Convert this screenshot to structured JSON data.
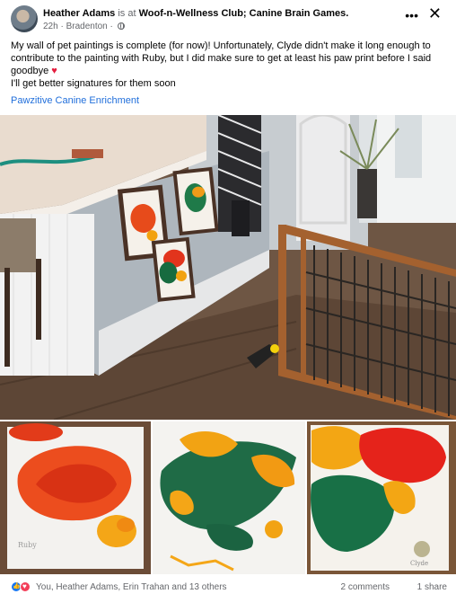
{
  "post": {
    "author": "Heather Adams",
    "is_at": "is at",
    "group": "Woof-n-Wellness Club; Canine Brain Games.",
    "time": "22h",
    "location": "Bradenton",
    "text_line1": "My wall of pet paintings is complete (for now)! Unfortunately, Clyde didn't make it long enough to contribute to the painting with Ruby, but I did make sure to get at least his paw print before I said goodbye",
    "text_line2": "I'll get better signatures for them soon",
    "tag": "Pawzitive Canine Enrichment"
  },
  "footer": {
    "reactors": "You, Heather Adams, Erin Trahan and 13 others",
    "comments": "2 comments",
    "shares": "1 share"
  },
  "icons": [
    "more-icon",
    "close-icon",
    "globe-icon",
    "heart-icon",
    "like-icon",
    "love-icon"
  ],
  "colors": {
    "link": "#216fdb",
    "secondary_text": "#65676b",
    "like": "#1877f2",
    "love": "#f33e58"
  }
}
